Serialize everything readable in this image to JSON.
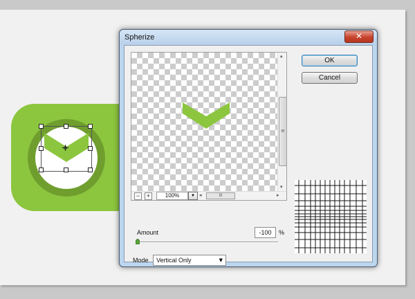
{
  "dialog": {
    "title": "Spherize",
    "close_glyph": "✕",
    "ok_label": "OK",
    "cancel_label": "Cancel"
  },
  "preview": {
    "zoom_out_glyph": "−",
    "zoom_in_glyph": "+",
    "zoom_value": "100%",
    "zoom_dropdown_glyph": "▼",
    "scroll_left_glyph": "◂",
    "scroll_right_glyph": "▸",
    "scroll_up_glyph": "▴",
    "scroll_down_glyph": "▾",
    "hthumb_glyph": "III",
    "vthumb_glyph": "≡",
    "shape_color": "#8cc63f"
  },
  "amount": {
    "label": "Amount",
    "value": "-100",
    "unit": "%",
    "slider_fraction": 0.0
  },
  "mode": {
    "label": "Mode",
    "value": "Vertical Only",
    "dropdown_glyph": "▼"
  },
  "icons": {
    "app_icon": "check-chevron-icon",
    "crosshair": "crosshair-icon",
    "slider_thumb": "slider-thumb-icon",
    "grid": "distortion-grid-icon"
  },
  "colors": {
    "accent_green": "#8cc63f",
    "ring_green": "#6f9e2e",
    "close_red": "#c7432c",
    "title_bar": "#bcd6ee"
  }
}
